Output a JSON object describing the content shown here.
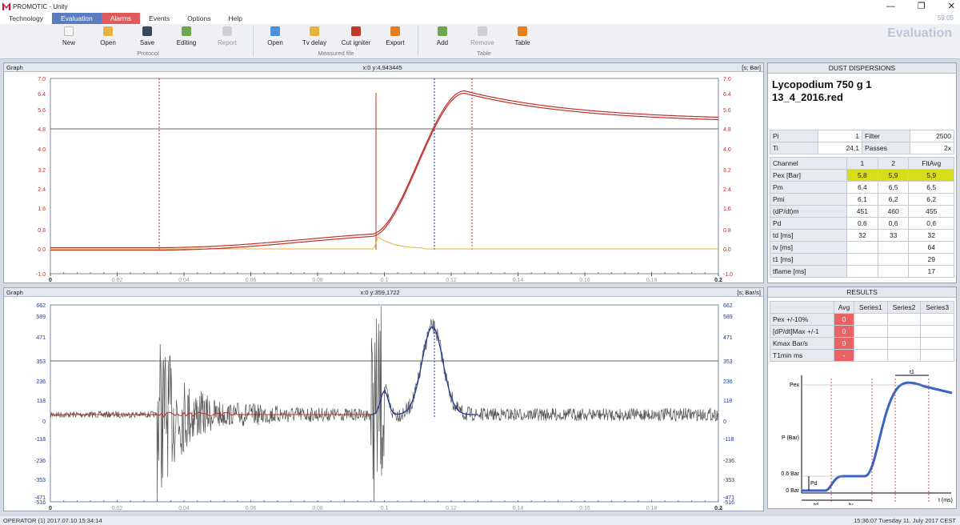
{
  "window": {
    "app_title": "PROMOTIC - Unity",
    "clock": "59:05",
    "controls": [
      "—",
      "❐",
      "✕"
    ]
  },
  "menu": [
    "Technology",
    "Evaluation",
    "Alarms",
    "Events",
    "Options",
    "Help"
  ],
  "ribbon": {
    "protocol": {
      "new": "New",
      "open": "Open",
      "save": "Save",
      "editing": "Editing",
      "report": "Report",
      "group": "Protocol"
    },
    "measured": {
      "open": "Open",
      "tv_delay": "Tv delay",
      "cut_igniter": "Cut igniter",
      "export": "Export",
      "group": "Measured file"
    },
    "table": {
      "add": "Add",
      "remove": "Remove",
      "table": "Table",
      "group": "Table"
    },
    "page_title": "Evaluation"
  },
  "graph1": {
    "title": "Graph",
    "cursor": "x:0 y:4,943445",
    "units": "[s; Bar]",
    "y_ticks": [
      "7.0",
      "6.4",
      "5.6",
      "4.8",
      "4.0",
      "3.2",
      "2.4",
      "1.6",
      "0.8",
      "0.0",
      "-1.0"
    ],
    "x_ticks": [
      "0",
      "0.02",
      "0.04",
      "0.06",
      "0.08",
      "0.1",
      "0.12",
      "0.14",
      "0.16",
      "0.18",
      "0.2"
    ]
  },
  "graph2": {
    "title": "Graph",
    "cursor": "x:0 y:359,1722",
    "units": "[s; Bar/s]",
    "y_ticks": [
      "662",
      "589",
      "471",
      "353",
      "236",
      "118",
      "0",
      "-118",
      "-236",
      "-353",
      "-471",
      "-516"
    ],
    "x_ticks": [
      "0",
      "0.02",
      "0.04",
      "0.06",
      "0.08",
      "0.1",
      "0.12",
      "0.14",
      "0.16",
      "0.18",
      "0.2"
    ]
  },
  "dust": {
    "header": "DUST DISPERSIONS",
    "file_title_1": "Lycopodium 750 g 1",
    "file_title_2": "13_4_2016.red",
    "params": [
      {
        "k1": "Pi",
        "v1": "1",
        "k2": "Filter",
        "v2": "2500"
      },
      {
        "k1": "Ti",
        "v1": "24,1",
        "k2": "Passes",
        "v2": "2x"
      }
    ],
    "channel_header": [
      "Channel",
      "1",
      "2",
      "FltAvg"
    ],
    "rows": [
      [
        "Pex [Bar]",
        "5,8",
        "5,9",
        "5,9"
      ],
      [
        "Pm",
        "6,4",
        "6,5",
        "6,5"
      ],
      [
        "Pmi",
        "6,1",
        "6,2",
        "6,2"
      ],
      [
        "(dP/dt)m",
        "451",
        "460",
        "455"
      ],
      [
        "Pd",
        "0,6",
        "0,6",
        "0,6"
      ],
      [
        "td [ms]",
        "32",
        "33",
        "32"
      ],
      [
        "tv [ms]",
        "",
        "",
        "64"
      ],
      [
        "t1 [ms]",
        "",
        "",
        "29"
      ],
      [
        "tflame [ms]",
        "",
        "",
        "17"
      ]
    ]
  },
  "results": {
    "header": "RESULTS",
    "columns": [
      "",
      "Avg",
      "Series1",
      "Series2",
      "Series3"
    ],
    "rows": [
      [
        "Pex +/-10%",
        "0"
      ],
      [
        "[dP/dt]Max +/-1",
        "0"
      ],
      [
        "Kmax Bar/s",
        "0"
      ],
      [
        "T1min ms",
        "-"
      ]
    ],
    "diagram": {
      "pex": "Pex",
      "p": "P (Bar)",
      "p06": "0.6 Bar",
      "p0": "0 Bar",
      "pd": "Pd",
      "t1": "t1",
      "td": "td",
      "tv": "tv",
      "t": "t (ms)"
    }
  },
  "status": {
    "left": "OPERATOR (1) 2017.07.10 15:34:14",
    "right": "15:36:07 Tuesday 11. July 2017 CEST"
  },
  "colors": {
    "accent": "#5a7dbf",
    "alarm": "#e05a5a",
    "pressure": "#c0302a",
    "derivative": "#1e3a9a",
    "curve": "#3a64c4"
  }
}
